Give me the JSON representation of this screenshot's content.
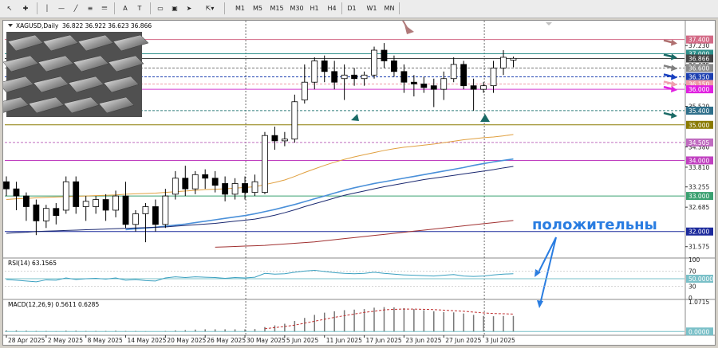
{
  "toolbar": {
    "timeframes": [
      "M1",
      "M5",
      "M15",
      "M30",
      "H1",
      "H4",
      "D1",
      "W1",
      "MN"
    ]
  },
  "header": {
    "symbol": "XAGUSD,Daily",
    "ohlc": "36.822 36.922 36.623 36.866"
  },
  "annotation": {
    "text": "положительны",
    "color": "#2a7de1"
  },
  "chart_data": {
    "type": "candlestick",
    "ylim": [
      31.3,
      37.75
    ],
    "candles": [
      {
        "o": 33.4,
        "h": 33.55,
        "c": 33.2,
        "l": 33.0
      },
      {
        "o": 33.2,
        "h": 33.4,
        "c": 33.0,
        "l": 32.6
      },
      {
        "o": 33.0,
        "h": 33.1,
        "c": 32.7,
        "l": 32.3
      },
      {
        "o": 32.75,
        "h": 32.9,
        "c": 32.3,
        "l": 31.9
      },
      {
        "o": 32.3,
        "h": 32.75,
        "c": 32.65,
        "l": 32.1
      },
      {
        "o": 32.65,
        "h": 32.8,
        "c": 32.45,
        "l": 32.2
      },
      {
        "o": 32.6,
        "h": 33.55,
        "c": 33.4,
        "l": 32.5
      },
      {
        "o": 33.4,
        "h": 33.55,
        "c": 32.7,
        "l": 32.5
      },
      {
        "o": 32.7,
        "h": 33.0,
        "c": 32.85,
        "l": 32.3
      },
      {
        "o": 32.7,
        "h": 33.0,
        "c": 32.9,
        "l": 32.5
      },
      {
        "o": 32.9,
        "h": 33.05,
        "c": 32.6,
        "l": 32.3
      },
      {
        "o": 32.6,
        "h": 33.15,
        "c": 33.0,
        "l": 32.4
      },
      {
        "o": 33.0,
        "h": 33.4,
        "c": 32.2,
        "l": 32.1
      },
      {
        "o": 32.2,
        "h": 32.6,
        "c": 32.5,
        "l": 32.0
      },
      {
        "o": 32.5,
        "h": 32.8,
        "c": 32.7,
        "l": 31.7
      },
      {
        "o": 32.7,
        "h": 32.9,
        "c": 32.2,
        "l": 32.0
      },
      {
        "o": 32.2,
        "h": 33.2,
        "c": 33.0,
        "l": 32.1
      },
      {
        "o": 33.05,
        "h": 33.7,
        "c": 33.5,
        "l": 32.9
      },
      {
        "o": 33.5,
        "h": 33.85,
        "c": 33.2,
        "l": 33.0
      },
      {
        "o": 33.2,
        "h": 33.7,
        "c": 33.6,
        "l": 33.05
      },
      {
        "o": 33.6,
        "h": 33.75,
        "c": 33.5,
        "l": 33.2
      },
      {
        "o": 33.5,
        "h": 33.7,
        "c": 33.3,
        "l": 33.1
      },
      {
        "o": 33.35,
        "h": 33.55,
        "c": 33.05,
        "l": 32.85
      },
      {
        "o": 33.05,
        "h": 33.5,
        "c": 33.35,
        "l": 32.9
      },
      {
        "o": 33.35,
        "h": 33.55,
        "c": 33.1,
        "l": 32.9
      },
      {
        "o": 33.1,
        "h": 33.6,
        "c": 33.4,
        "l": 33.0
      },
      {
        "o": 33.1,
        "h": 34.8,
        "c": 34.7,
        "l": 33.05
      },
      {
        "o": 34.7,
        "h": 34.95,
        "c": 34.55,
        "l": 34.3
      },
      {
        "o": 34.55,
        "h": 34.8,
        "c": 34.6,
        "l": 34.4
      },
      {
        "o": 34.6,
        "h": 35.85,
        "c": 35.65,
        "l": 34.5
      },
      {
        "o": 35.7,
        "h": 36.7,
        "c": 36.2,
        "l": 35.6
      },
      {
        "o": 36.2,
        "h": 36.9,
        "c": 36.8,
        "l": 36.0
      },
      {
        "o": 36.8,
        "h": 36.95,
        "c": 36.5,
        "l": 36.2
      },
      {
        "o": 36.5,
        "h": 36.8,
        "c": 36.2,
        "l": 36.0
      },
      {
        "o": 36.3,
        "h": 36.7,
        "c": 36.4,
        "l": 35.7
      },
      {
        "o": 36.4,
        "h": 36.6,
        "c": 36.3,
        "l": 36.1
      },
      {
        "o": 36.3,
        "h": 36.5,
        "c": 36.4,
        "l": 36.1
      },
      {
        "o": 36.4,
        "h": 37.2,
        "c": 37.1,
        "l": 36.3
      },
      {
        "o": 37.1,
        "h": 37.3,
        "c": 36.8,
        "l": 36.6
      },
      {
        "o": 36.8,
        "h": 36.95,
        "c": 36.5,
        "l": 36.35
      },
      {
        "o": 36.5,
        "h": 36.7,
        "c": 36.2,
        "l": 35.9
      },
      {
        "o": 36.2,
        "h": 36.4,
        "c": 36.15,
        "l": 35.8
      },
      {
        "o": 36.15,
        "h": 36.35,
        "c": 36.05,
        "l": 35.9
      },
      {
        "o": 36.1,
        "h": 36.3,
        "c": 36.0,
        "l": 35.5
      },
      {
        "o": 36.0,
        "h": 36.5,
        "c": 36.3,
        "l": 35.7
      },
      {
        "o": 36.3,
        "h": 36.9,
        "c": 36.7,
        "l": 36.2
      },
      {
        "o": 36.7,
        "h": 36.8,
        "c": 36.1,
        "l": 36.0
      },
      {
        "o": 36.1,
        "h": 36.3,
        "c": 36.0,
        "l": 35.4
      },
      {
        "o": 36.0,
        "h": 36.2,
        "c": 36.1,
        "l": 35.9
      },
      {
        "o": 36.1,
        "h": 36.8,
        "c": 36.6,
        "l": 35.9
      },
      {
        "o": 36.6,
        "h": 37.1,
        "c": 36.9,
        "l": 36.4
      },
      {
        "o": 36.82,
        "h": 36.92,
        "c": 36.87,
        "l": 36.62
      }
    ],
    "price_ticks": [
      {
        "v": 37.23,
        "label": "37.230"
      },
      {
        "v": 36.675,
        "label": "36.675"
      },
      {
        "v": 36.12,
        "label": "36.120"
      },
      {
        "v": 35.52,
        "label": "35.520"
      },
      {
        "v": 34.38,
        "label": "34.380"
      },
      {
        "v": 33.81,
        "label": "33.810"
      },
      {
        "v": 33.255,
        "label": "33.255"
      },
      {
        "v": 32.685,
        "label": "32.685"
      },
      {
        "v": 31.575,
        "label": "31.575"
      }
    ],
    "levels": [
      {
        "v": 37.4,
        "label": "37.400",
        "color": "#d36a86",
        "bg": "#d36a86"
      },
      {
        "v": 37.0,
        "label": "37.000",
        "color": "#2e8f8a",
        "bg": "#2e8f8a"
      },
      {
        "v": 36.866,
        "label": "36.866",
        "color": "#444444",
        "bg": "#444444"
      },
      {
        "v": 36.6,
        "label": "36.600",
        "color": "#777777",
        "bg": "#8a8a8a",
        "dash": true
      },
      {
        "v": 36.35,
        "label": "36.350",
        "color": "#1c3fb0",
        "bg": "#1c3fb0",
        "dash": true
      },
      {
        "v": 36.15,
        "label": "36.150",
        "color": "#ee9aa8",
        "bg": "#ee9aa8",
        "dash": true
      },
      {
        "v": 36.0,
        "label": "36.000",
        "color": "#d23ad2",
        "bg": "#e020e0"
      },
      {
        "v": 35.4,
        "label": "35.400",
        "color": "#2e7c7a",
        "bg": "#2e6f8a",
        "dash": true
      },
      {
        "v": 35.0,
        "label": "35.000",
        "color": "#8a7a00",
        "bg": "#8a7a00"
      },
      {
        "v": 34.505,
        "label": "34.505",
        "color": "#c06cc0",
        "bg": "#c06cc0",
        "dash": true
      },
      {
        "v": 34.0,
        "label": "34.000",
        "color": "#c040c0",
        "bg": "#c040c0"
      },
      {
        "v": 33.0,
        "label": "33.000",
        "color": "#3aa070",
        "bg": "#3aa070"
      },
      {
        "v": 32.0,
        "label": "32.000",
        "color": "#1c2a9c",
        "bg": "#1c2a9c"
      }
    ],
    "x_labels": [
      "28 Apr 2025",
      "2 May 2025",
      "8 May 2025",
      "14 May 2025",
      "20 May 2025",
      "26 May 2025",
      "30 May 2025",
      "5 Jun 2025",
      "11 Jun 2025",
      "17 Jun 2025",
      "23 Jun 2025",
      "27 Jun 2025",
      "3 Jul 2025"
    ],
    "x_label_index": [
      0,
      4,
      8,
      12,
      16,
      20,
      24,
      28,
      32,
      36,
      40,
      44,
      48
    ],
    "ma_lines": [
      {
        "name": "orange",
        "color": "#e0a040",
        "from": 0,
        "values": [
          32.9,
          32.92,
          32.93,
          32.95,
          32.96,
          32.97,
          32.98,
          32.99,
          33.0,
          33.01,
          33.02,
          33.03,
          33.05,
          33.06,
          33.07,
          33.08,
          33.1,
          33.12,
          33.14,
          33.16,
          33.18,
          33.19,
          33.2,
          33.22,
          33.24,
          33.26,
          33.32,
          33.38,
          33.45,
          33.55,
          33.66,
          33.76,
          33.86,
          33.95,
          34.03,
          34.1,
          34.16,
          34.22,
          34.28,
          34.33,
          34.37,
          34.4,
          34.43,
          34.46,
          34.5,
          34.54,
          34.58,
          34.61,
          34.64,
          34.66,
          34.69,
          34.73
        ]
      },
      {
        "name": "blue",
        "color": "#4a90d9",
        "from": 12,
        "values": [
          32.05,
          32.08,
          32.1,
          32.12,
          32.15,
          32.18,
          32.21,
          32.25,
          32.29,
          32.33,
          32.37,
          32.41,
          32.45,
          32.5,
          32.56,
          32.62,
          32.69,
          32.76,
          32.84,
          32.92,
          33.0,
          33.08,
          33.16,
          33.23,
          33.29,
          33.35,
          33.4,
          33.45,
          33.5,
          33.55,
          33.6,
          33.65,
          33.7,
          33.75,
          33.8,
          33.86,
          33.91,
          33.96,
          34.0,
          34.04
        ]
      },
      {
        "name": "navy",
        "color": "#1a2870",
        "from": 0,
        "values": [
          31.95,
          31.97,
          31.98,
          32.0,
          32.01,
          32.02,
          32.03,
          32.04,
          32.05,
          32.06,
          32.07,
          32.08,
          32.09,
          32.1,
          32.11,
          32.12,
          32.13,
          32.15,
          32.17,
          32.19,
          32.21,
          32.23,
          32.26,
          32.29,
          32.32,
          32.35,
          32.4,
          32.46,
          32.53,
          32.61,
          32.7,
          32.78,
          32.86,
          32.94,
          33.02,
          33.08,
          33.14,
          33.2,
          33.26,
          33.31,
          33.36,
          33.41,
          33.46,
          33.5,
          33.54,
          33.58,
          33.62,
          33.66,
          33.7,
          33.74,
          33.79,
          33.83
        ]
      },
      {
        "name": "darkred",
        "color": "#a03030",
        "from": 21,
        "values": [
          31.56,
          31.57,
          31.58,
          31.59,
          31.6,
          31.61,
          31.63,
          31.65,
          31.67,
          31.69,
          31.71,
          31.74,
          31.77,
          31.8,
          31.83,
          31.86,
          31.89,
          31.92,
          31.95,
          31.98,
          32.01,
          32.04,
          32.07,
          32.1,
          32.13,
          32.16,
          32.19,
          32.22,
          32.25,
          32.28,
          32.31
        ]
      }
    ],
    "rsi": {
      "label": "RSI(14) 63.1565",
      "ticks": [
        {
          "v": 100,
          "label": "100"
        },
        {
          "v": 70,
          "label": "70"
        },
        {
          "v": 30,
          "label": "30"
        },
        {
          "v": 0,
          "label": "0"
        }
      ],
      "level": {
        "v": 50,
        "label": "50.0000"
      },
      "values": [
        48,
        46,
        44,
        42,
        47,
        46,
        52,
        48,
        50,
        51,
        49,
        52,
        46,
        48,
        45,
        44,
        52,
        55,
        53,
        55,
        54,
        53,
        51,
        53,
        52,
        54,
        64,
        62,
        63,
        67,
        70,
        72,
        69,
        66,
        64,
        63,
        64,
        67,
        64,
        62,
        60,
        59,
        58,
        57,
        59,
        61,
        57,
        56,
        57,
        60,
        62,
        63
      ]
    },
    "macd": {
      "label": "MACD(12,26,9) 0.5611 0.6285",
      "ticks": [
        {
          "v": 1.0715,
          "label": "1.0715"
        }
      ],
      "zero": {
        "v": 0,
        "label": "0.0000"
      },
      "range": [
        -0.05,
        1.1
      ],
      "hist": [
        0.04,
        0.04,
        0.03,
        0.02,
        0.02,
        0.01,
        0.03,
        0.03,
        0.02,
        0.02,
        0.02,
        0.03,
        0.02,
        0.02,
        0.01,
        0.0,
        0.02,
        0.04,
        0.05,
        0.07,
        0.08,
        0.08,
        0.08,
        0.08,
        0.08,
        0.09,
        0.16,
        0.22,
        0.28,
        0.38,
        0.49,
        0.6,
        0.68,
        0.73,
        0.77,
        0.79,
        0.81,
        0.86,
        0.88,
        0.87,
        0.84,
        0.81,
        0.77,
        0.73,
        0.7,
        0.69,
        0.65,
        0.6,
        0.56,
        0.55,
        0.56,
        0.56
      ],
      "signal": [
        null,
        null,
        null,
        null,
        null,
        null,
        null,
        null,
        null,
        null,
        null,
        null,
        null,
        null,
        null,
        null,
        null,
        null,
        null,
        null,
        null,
        null,
        null,
        null,
        null,
        null,
        0.1,
        0.14,
        0.18,
        0.23,
        0.3,
        0.37,
        0.44,
        0.51,
        0.57,
        0.63,
        0.69,
        0.73,
        0.78,
        0.8,
        0.81,
        0.81,
        0.8,
        0.79,
        0.77,
        0.75,
        0.73,
        0.7,
        0.67,
        0.65,
        0.64,
        0.63
      ]
    }
  }
}
